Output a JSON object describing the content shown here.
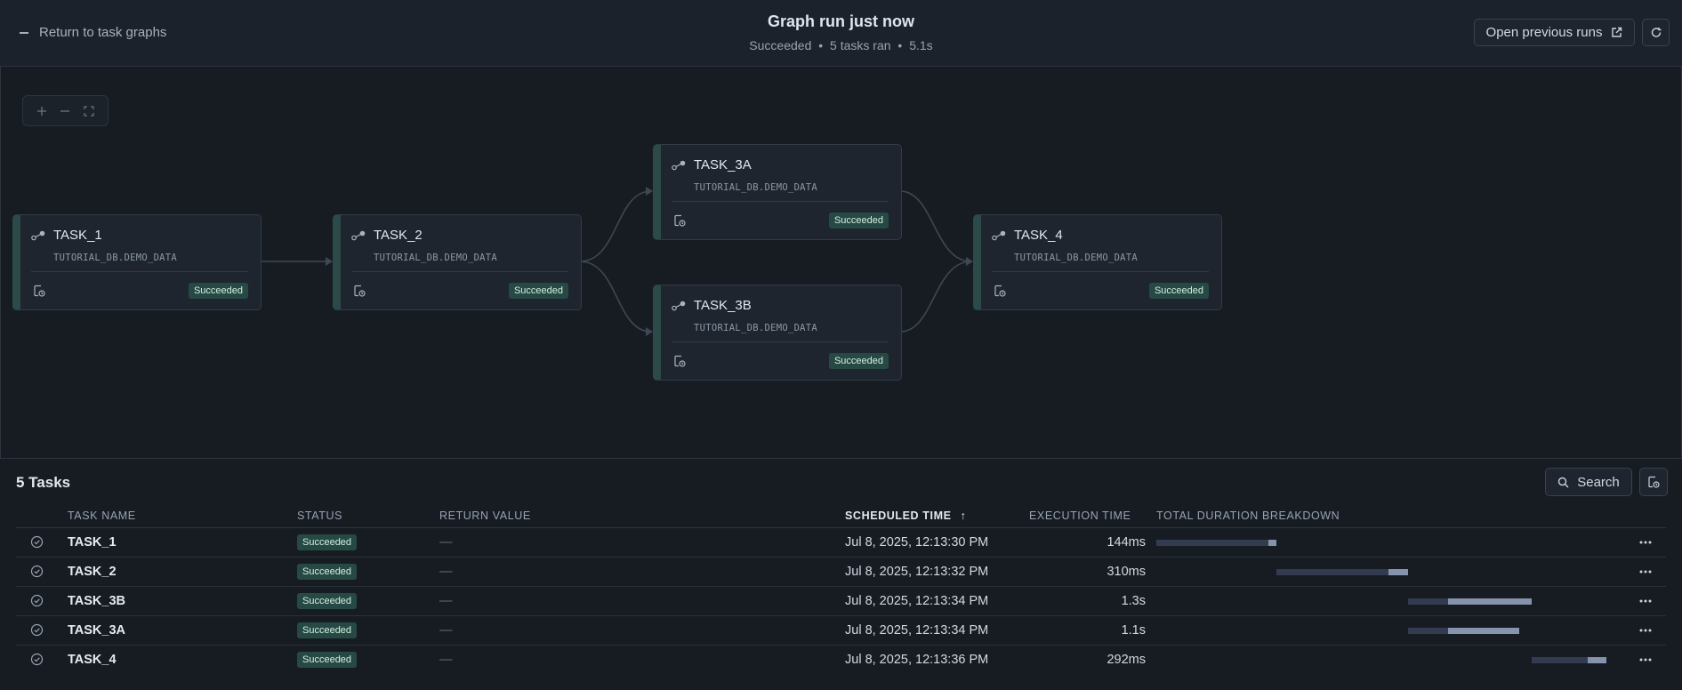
{
  "header": {
    "back_label": "Return to task graphs",
    "title": "Graph run just now",
    "subtitle_status": "Succeeded",
    "subtitle_tasks": "5 tasks ran",
    "subtitle_duration": "5.1s",
    "subtitle_sep": "•",
    "open_previous_label": "Open previous runs"
  },
  "graph": {
    "nodes": [
      {
        "name": "TASK_1",
        "db": "TUTORIAL_DB.DEMO_DATA",
        "status": "Succeeded"
      },
      {
        "name": "TASK_2",
        "db": "TUTORIAL_DB.DEMO_DATA",
        "status": "Succeeded"
      },
      {
        "name": "TASK_3A",
        "db": "TUTORIAL_DB.DEMO_DATA",
        "status": "Succeeded"
      },
      {
        "name": "TASK_3B",
        "db": "TUTORIAL_DB.DEMO_DATA",
        "status": "Succeeded"
      },
      {
        "name": "TASK_4",
        "db": "TUTORIAL_DB.DEMO_DATA",
        "status": "Succeeded"
      }
    ]
  },
  "tasks_panel": {
    "title": "5 Tasks",
    "search_label": "Search",
    "columns": {
      "task_name": "TASK NAME",
      "status": "STATUS",
      "return_value": "RETURN VALUE",
      "scheduled_time": "SCHEDULED TIME",
      "execution_time": "EXECUTION TIME",
      "duration_breakdown": "TOTAL DURATION BREAKDOWN"
    },
    "sort_indicator": "↑",
    "rows": [
      {
        "name": "TASK_1",
        "status": "Succeeded",
        "return_value": "—",
        "scheduled": "Jul 8, 2025, 12:13:30 PM",
        "execution": "144ms"
      },
      {
        "name": "TASK_2",
        "status": "Succeeded",
        "return_value": "—",
        "scheduled": "Jul 8, 2025, 12:13:32 PM",
        "execution": "310ms"
      },
      {
        "name": "TASK_3B",
        "status": "Succeeded",
        "return_value": "—",
        "scheduled": "Jul 8, 2025, 12:13:34 PM",
        "execution": "1.3s"
      },
      {
        "name": "TASK_3A",
        "status": "Succeeded",
        "return_value": "—",
        "scheduled": "Jul 8, 2025, 12:13:34 PM",
        "execution": "1.1s"
      },
      {
        "name": "TASK_4",
        "status": "Succeeded",
        "return_value": "—",
        "scheduled": "Jul 8, 2025, 12:13:36 PM",
        "execution": "292ms"
      }
    ]
  },
  "icons": {
    "back": "minus-icon",
    "external": "external-link-icon",
    "refresh": "refresh-icon",
    "zoom_in": "plus-icon",
    "zoom_out": "minus-icon",
    "fit": "fit-view-icon",
    "task": "task-node-icon",
    "schedule": "schedule-icon",
    "row_status": "check-circle-icon",
    "search": "search-icon",
    "export": "export-icon",
    "more": "more-icon"
  },
  "colors": {
    "background": "#171c23",
    "success_badge_bg": "#264a43",
    "node_accent": "#2c4a48",
    "bar_run": "#8593ad",
    "bar_wait": "#323b4f"
  }
}
